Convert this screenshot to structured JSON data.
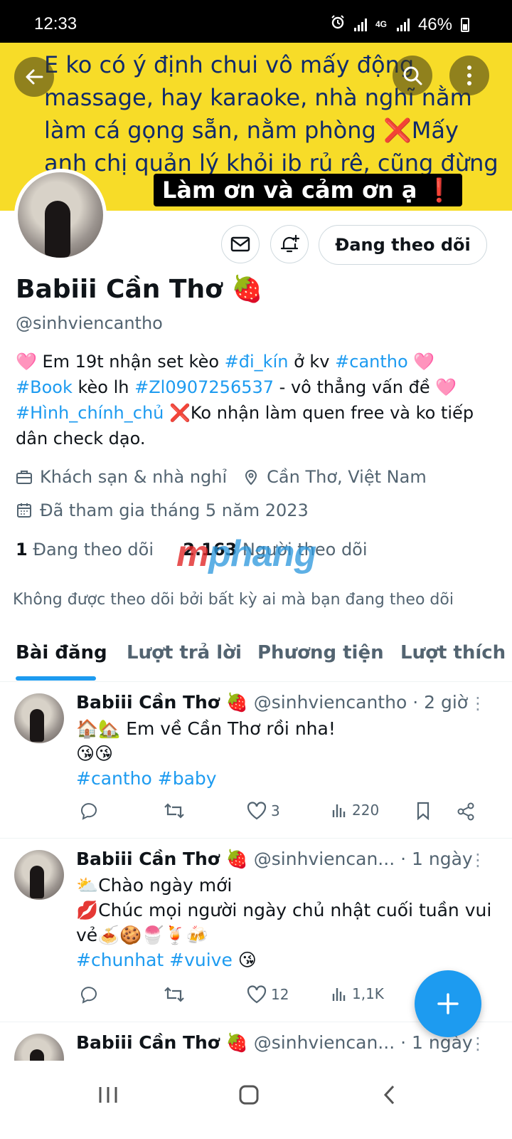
{
  "status_bar": {
    "time": "12:33",
    "network": "4G",
    "battery": "46%"
  },
  "banner": {
    "text": "E ko có ý định chui vô mấy động massage, hay karaoke, nhà nghĩ nằm làm cá gọng sẵn, nằm phòng ❌Mấy anh chị quản lý khỏi ib rủ rê, cũng đừng phá!",
    "pill": "Làm ơn và cảm ơn ạ",
    "pill_mark": "❗"
  },
  "profile": {
    "follow_button": "Đang theo dõi",
    "name": "Babiii Cần Thơ 🍓",
    "handle": "@sinhviencantho",
    "bio": [
      [
        {
          "t": "🩷 Em 19t nhận set kèo "
        },
        {
          "t": "#đi_kín",
          "tag": true
        },
        {
          "t": " ở kv "
        },
        {
          "t": "#cantho",
          "tag": true
        },
        {
          "t": "  🩷"
        }
      ],
      [
        {
          "t": "#Book",
          "tag": true
        },
        {
          "t": " kèo lh "
        },
        {
          "t": "#Zl0907256537",
          "tag": true
        },
        {
          "t": " - vô thẳng vấn đề 🩷"
        }
      ],
      [
        {
          "t": "#Hình_chính_chủ",
          "tag": true
        },
        {
          "t": " ❌Ko nhận làm quen free và ko tiếp dân check dạo."
        }
      ]
    ],
    "category": "Khách sạn & nhà nghỉ",
    "location": "Cần Thơ, Việt Nam",
    "joined": "Đã tham gia tháng 5 năm 2023",
    "following_count": "1",
    "following_label": "Đang theo dõi",
    "followers_count": "2.163",
    "followers_label": "Người theo dõi",
    "not_followed_note": "Không được theo dõi bởi bất kỳ ai mà bạn đang theo dõi"
  },
  "watermark": {
    "lead": "m",
    "rest": "phang"
  },
  "tabs": [
    "Bài đăng",
    "Lượt trả lời",
    "Phương tiện",
    "Lượt thích"
  ],
  "posts": [
    {
      "name": "Babiii Cần Thơ 🍓",
      "handle": "@sinhviencantho",
      "time": "· 2 giờ",
      "lines": [
        "🏠🏡 Em về Cần Thơ rồi nha!",
        "😘😘"
      ],
      "hashtags": "#cantho #baby",
      "likes": "3",
      "views": "220"
    },
    {
      "name": "Babiii Cần Thơ 🍓",
      "handle": "@sinhviencan...",
      "time": "· 1 ngày",
      "lines": [
        "⛅Chào ngày mới",
        "💋Chúc mọi người ngày chủ nhật cuối tuần vui vẻ🍝🍪🍧🍹🍻"
      ],
      "hashtags": "#chunhat #vuive",
      "hashtags_suffix": " 😘",
      "likes": "12",
      "views": "1,1K"
    },
    {
      "name": "Babiii Cần Thơ 🍓",
      "handle": "@sinhviencan...",
      "time": "· 1 ngày"
    }
  ],
  "colors": {
    "accent": "#1d9bf0",
    "banner": "#f7dc28",
    "text": "#0f1419",
    "muted": "#536471"
  }
}
